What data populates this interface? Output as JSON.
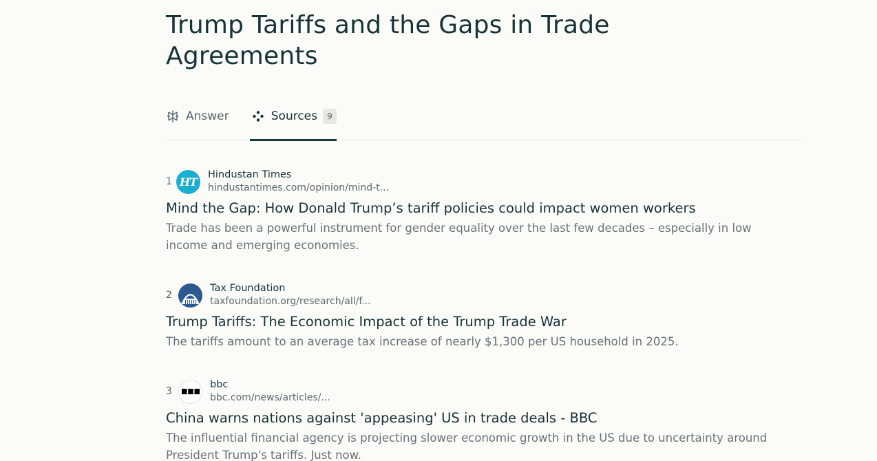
{
  "page": {
    "title": "Trump Tariffs and the Gaps in Trade Agreements"
  },
  "tabs": {
    "answer_label": "Answer",
    "sources_label": "Sources",
    "sources_count": "9"
  },
  "sources": [
    {
      "number": "1",
      "name": "Hindustan Times",
      "url": "hindustantimes.com/opinion/mind-t...",
      "title": "Mind the Gap: How Donald Trump’s tariff policies could impact women workers",
      "snippet": "Trade has been a powerful instrument for gender equality over the last few decades – especially in low income and emerging economies.",
      "logo_icon": "hindustan-times-logo",
      "logo_color": "#1aaed1",
      "logo_text": "HT"
    },
    {
      "number": "2",
      "name": "Tax Foundation",
      "url": "taxfoundation.org/research/all/f...",
      "title": "Trump Tariffs: The Economic Impact of the Trump Trade War",
      "snippet": "The tariffs amount to an average tax increase of nearly $1,300 per US household in 2025.",
      "logo_icon": "tax-foundation-capitol-logo",
      "logo_color": "#2d5a8e"
    },
    {
      "number": "3",
      "name": "bbc",
      "url": "bbc.com/news/articles/...",
      "title": "China warns nations against 'appeasing' US in trade deals - BBC",
      "snippet": "The influential financial agency is projecting slower economic growth in the US due to uncertainty around President Trump's tariffs. Just now.",
      "logo_icon": "bbc-logo",
      "logo_color": "#000000"
    }
  ]
}
